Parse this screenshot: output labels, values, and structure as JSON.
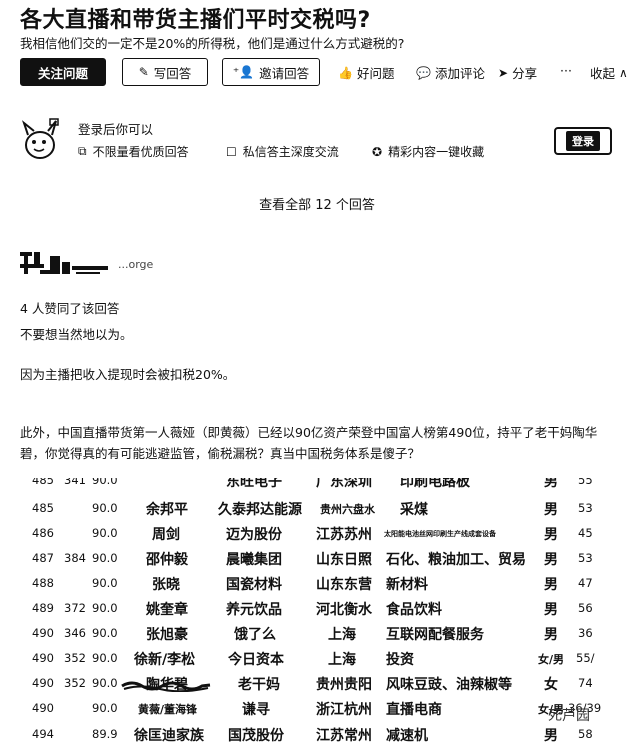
{
  "question": {
    "title": "各大直播和带货主播们平时交税吗?",
    "detail": "我相信他们交的一定不是20%的所得税，他们是通过什么方式避税的?"
  },
  "actions": {
    "follow": "关注问题",
    "write": "写回答",
    "invite": "邀请回答",
    "good": "好问题",
    "comment": "添加评论",
    "share": "分享",
    "more": "···",
    "collapse": "收起"
  },
  "login": {
    "title": "登录后你可以",
    "perks": [
      "不限量看优质回答",
      "私信答主深度交流",
      "精彩内容一键收藏"
    ],
    "button": "登录"
  },
  "answers": {
    "view_all": "查看全部 12 个回答",
    "author_name": "...orge",
    "upvotes": "4 人赞同了该回答",
    "p1": "不要想当然地以为。",
    "p2": "因为主播把收入提现时会被扣税20%。",
    "p3": "此外，中国直播带货第一人薇娅（即黄薇）已经以90亿资产荣登中国富人榜第490位，持平了老干妈陶华碧，你觉得真的有可能逃避监管，偷税漏税？真当中国税务体系是傻子？"
  },
  "table": {
    "rows": [
      {
        "rank": "485",
        "prev": "341",
        "wealth": "90.0",
        "name": "",
        "company": "东旺电子",
        "location": "广东深圳",
        "industry": "印刷电路板",
        "gender": "男",
        "age": "55"
      },
      {
        "rank": "485",
        "prev": "",
        "wealth": "90.0",
        "name": "余邦平",
        "company": "久泰邦达能源",
        "location": "贵州六盘水",
        "industry": "采煤",
        "gender": "男",
        "age": "53"
      },
      {
        "rank": "486",
        "prev": "",
        "wealth": "90.0",
        "name": "周剑",
        "company": "迈为股份",
        "location": "江苏苏州",
        "industry": "太阳能电池丝网印刷生产线成套设备",
        "gender": "男",
        "age": "45"
      },
      {
        "rank": "487",
        "prev": "384",
        "wealth": "90.0",
        "name": "邵仲毅",
        "company": "晨曦集团",
        "location": "山东日照",
        "industry": "石化、粮油加工、贸易",
        "gender": "男",
        "age": "53"
      },
      {
        "rank": "488",
        "prev": "",
        "wealth": "90.0",
        "name": "张晓",
        "company": "国瓷材料",
        "location": "山东东营",
        "industry": "新材料",
        "gender": "男",
        "age": "47"
      },
      {
        "rank": "489",
        "prev": "372",
        "wealth": "90.0",
        "name": "姚奎章",
        "company": "养元饮品",
        "location": "河北衡水",
        "industry": "食品饮料",
        "gender": "男",
        "age": "56"
      },
      {
        "rank": "490",
        "prev": "346",
        "wealth": "90.0",
        "name": "张旭豪",
        "company": "饿了么",
        "location": "上海",
        "industry": "互联网配餐服务",
        "gender": "男",
        "age": "36"
      },
      {
        "rank": "490",
        "prev": "352",
        "wealth": "90.0",
        "name": "徐新/李松",
        "company": "今日资本",
        "location": "上海",
        "industry": "投资",
        "gender": "女/男",
        "age": "55/"
      },
      {
        "rank": "490",
        "prev": "352",
        "wealth": "90.0",
        "name": "陶华碧",
        "company": "老干妈",
        "location": "贵州贵阳",
        "industry": "风味豆豉、油辣椒等",
        "gender": "女",
        "age": "74"
      },
      {
        "rank": "490",
        "prev": "",
        "wealth": "90.0",
        "name": "黄薇/董海锋",
        "company": "谦寻",
        "location": "浙江杭州",
        "industry": "直播电商",
        "gender": "女/男",
        "age": "36/39"
      },
      {
        "rank": "494",
        "prev": "",
        "wealth": "89.9",
        "name": "徐匡迪家族",
        "company": "国茂股份",
        "location": "江苏常州",
        "industry": "减速机",
        "gender": "男",
        "age": "58"
      }
    ],
    "watermark": "死芦园"
  }
}
